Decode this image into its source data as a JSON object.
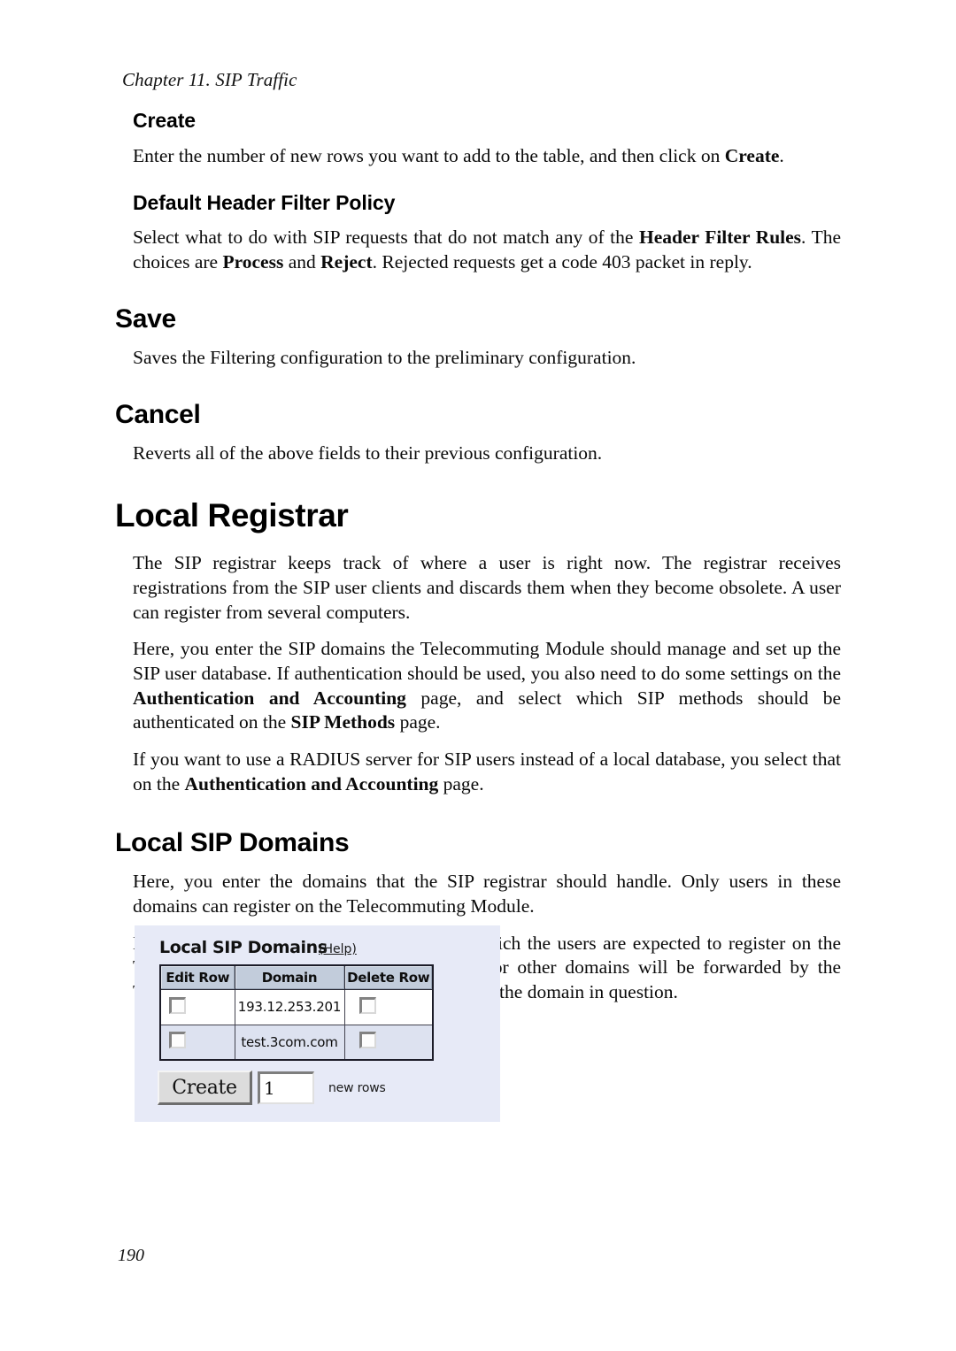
{
  "document": {
    "running_header": "Chapter 11. SIP Traffic",
    "page_number": "190"
  },
  "sections": {
    "create": {
      "heading": "Create",
      "body_pre": "Enter the number of new rows you want to add to the table, and then click on ",
      "body_bold": "Create",
      "body_post": "."
    },
    "default_header_filter_policy": {
      "heading": "Default Header Filter Policy",
      "p1_a": "Select what to do with SIP requests that do not match any of the ",
      "p1_b": "Header Filter Rules",
      "p1_c": ". The choices are ",
      "p1_d": "Process",
      "p1_e": " and ",
      "p1_f": "Reject",
      "p1_g": ". Rejected requests get a code 403 packet in reply."
    },
    "save": {
      "heading": "Save",
      "body": "Saves the Filtering configuration to the preliminary configuration."
    },
    "cancel": {
      "heading": "Cancel",
      "body": "Reverts all of the above fields to their previous configuration."
    },
    "local_registrar": {
      "heading": "Local Registrar",
      "p1": "The SIP registrar keeps track of where a user is right now. The registrar receives registrations from the SIP user clients and discards them when they become obsolete. A user can register from several computers.",
      "p2_a": "Here, you enter the SIP domains the Telecommuting Module should manage and set up the SIP user database. If authentication should be used, you also need to do some settings on the ",
      "p2_b": "Authentication and Accounting",
      "p2_c": " page, and select which SIP methods should be authenticated on the ",
      "p2_d": "SIP Methods",
      "p2_e": " page.",
      "p3_a": "If you want to use a RADIUS server for SIP users instead of a local database, you select that on the ",
      "p3_b": "Authentication and Accounting",
      "p3_c": " page."
    },
    "local_sip_domains": {
      "heading": "Local SIP Domains",
      "p1": "Here, you enter the domains that the SIP registrar should handle. Only users in these domains can register on the Telecommuting Module.",
      "p2": "Note that you should only list domains for which the users are expected to register on the Telecommuting Module itself. SIP requests for other domains will be forwarded by the Telecommuting Module to the server managing the domain in question."
    }
  },
  "widget": {
    "title": "Local SIP Domains",
    "help_link": "(Help)",
    "table": {
      "columns": [
        "Edit Row",
        "Domain",
        "Delete Row"
      ],
      "rows": [
        {
          "edit_checked": false,
          "domain": "193.12.253.201",
          "delete_checked": false
        },
        {
          "edit_checked": false,
          "domain": "test.3com.com",
          "delete_checked": false
        }
      ]
    },
    "create_button_label": "Create",
    "new_rows_value": "1",
    "new_rows_label": "new rows",
    "colors": {
      "panel_background": "#e7eaf7",
      "header_cell": "#c2ccdb",
      "row_alt": "#dde2f0",
      "button_face": "#dcdcdc"
    }
  }
}
